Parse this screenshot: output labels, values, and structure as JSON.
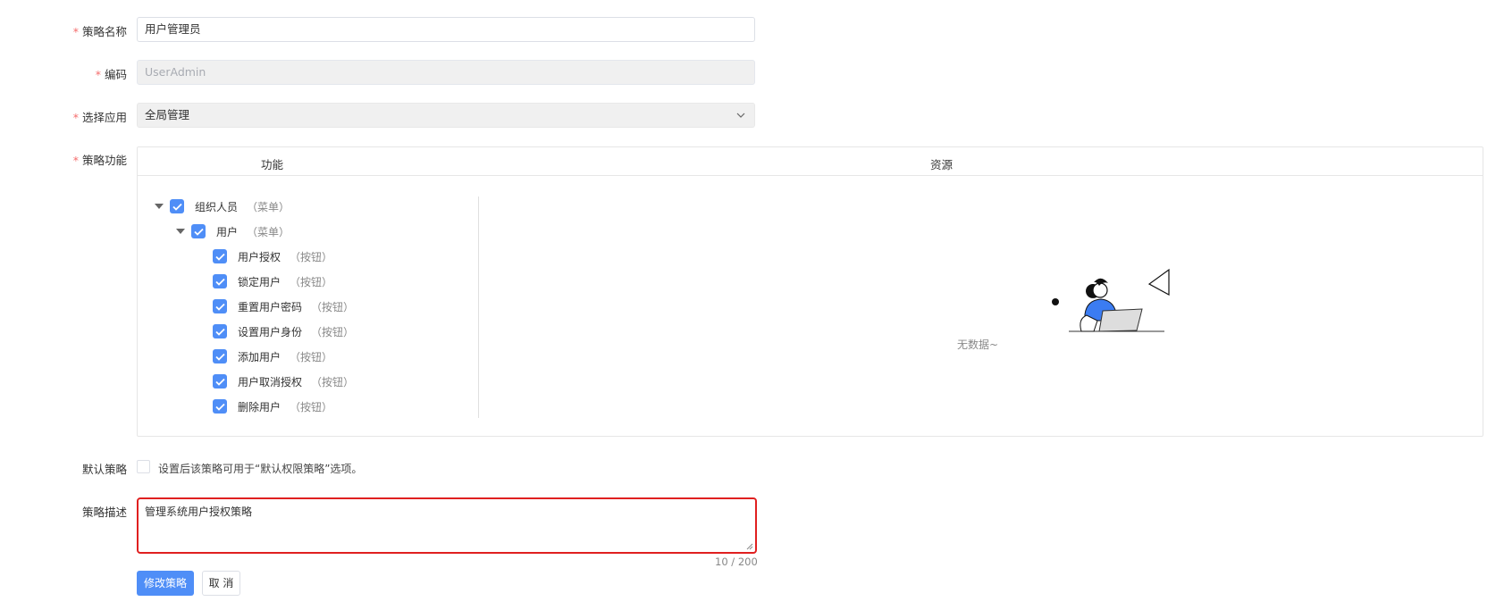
{
  "form": {
    "name": {
      "label": "策略名称",
      "value": "用户管理员"
    },
    "code": {
      "label": "编码",
      "placeholder": "UserAdmin"
    },
    "app": {
      "label": "选择应用",
      "value": "全局管理"
    },
    "features": {
      "label": "策略功能",
      "col_feature": "功能",
      "col_resource": "资源",
      "tree": [
        {
          "name": "组织人员",
          "type": "（菜单）",
          "checked": true
        },
        {
          "name": "用户",
          "type": "（菜单）",
          "checked": true
        },
        {
          "name": "用户授权",
          "type": "（按钮）",
          "checked": true
        },
        {
          "name": "锁定用户",
          "type": "（按钮）",
          "checked": true
        },
        {
          "name": "重置用户密码",
          "type": "（按钮）",
          "checked": true
        },
        {
          "name": "设置用户身份",
          "type": "（按钮）",
          "checked": true
        },
        {
          "name": "添加用户",
          "type": "（按钮）",
          "checked": true
        },
        {
          "name": "用户取消授权",
          "type": "（按钮）",
          "checked": true
        },
        {
          "name": "删除用户",
          "type": "（按钮）",
          "checked": true
        }
      ],
      "empty_text": "无数据~"
    },
    "default_policy": {
      "label": "默认策略",
      "hint": "设置后该策略可用于“默认权限策略”选项。",
      "checked": false
    },
    "description": {
      "label": "策略描述",
      "value": "管理系统用户授权策略",
      "count": "10 / 200"
    },
    "submit_label": "修改策略",
    "cancel_label": "取 消"
  },
  "colors": {
    "primary": "#4f8ef7",
    "required": "#f56c6c",
    "focus_border": "#e02020"
  }
}
